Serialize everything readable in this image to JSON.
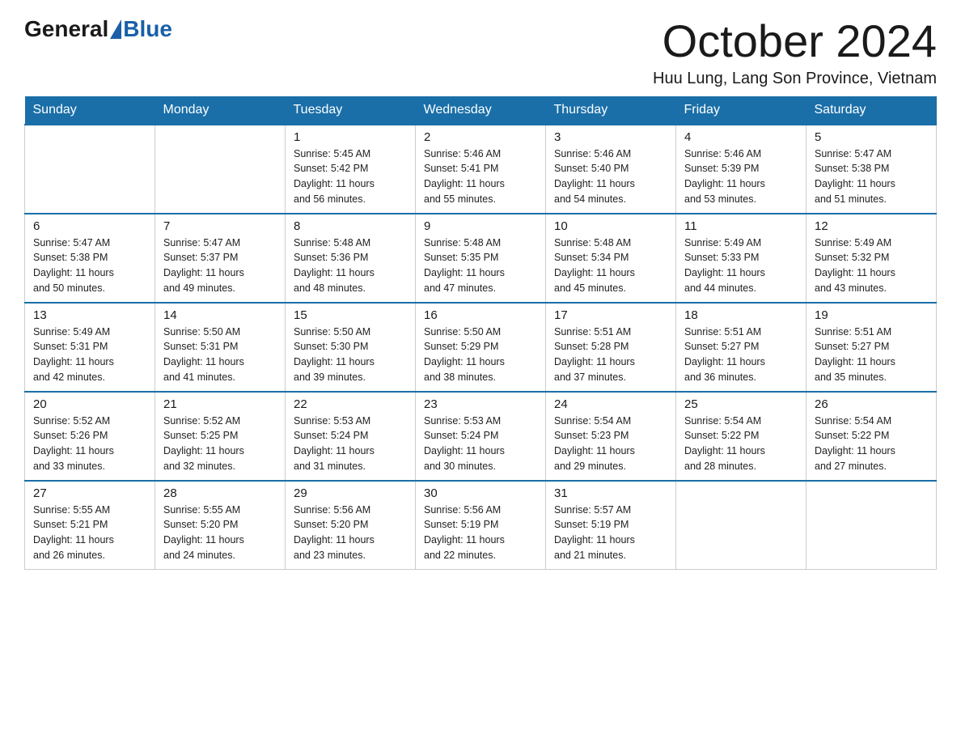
{
  "logo": {
    "general": "General",
    "blue": "Blue"
  },
  "title": {
    "month": "October 2024",
    "location": "Huu Lung, Lang Son Province, Vietnam"
  },
  "days_of_week": [
    "Sunday",
    "Monday",
    "Tuesday",
    "Wednesday",
    "Thursday",
    "Friday",
    "Saturday"
  ],
  "weeks": [
    [
      {
        "day": "",
        "info": ""
      },
      {
        "day": "",
        "info": ""
      },
      {
        "day": "1",
        "info": "Sunrise: 5:45 AM\nSunset: 5:42 PM\nDaylight: 11 hours\nand 56 minutes."
      },
      {
        "day": "2",
        "info": "Sunrise: 5:46 AM\nSunset: 5:41 PM\nDaylight: 11 hours\nand 55 minutes."
      },
      {
        "day": "3",
        "info": "Sunrise: 5:46 AM\nSunset: 5:40 PM\nDaylight: 11 hours\nand 54 minutes."
      },
      {
        "day": "4",
        "info": "Sunrise: 5:46 AM\nSunset: 5:39 PM\nDaylight: 11 hours\nand 53 minutes."
      },
      {
        "day": "5",
        "info": "Sunrise: 5:47 AM\nSunset: 5:38 PM\nDaylight: 11 hours\nand 51 minutes."
      }
    ],
    [
      {
        "day": "6",
        "info": "Sunrise: 5:47 AM\nSunset: 5:38 PM\nDaylight: 11 hours\nand 50 minutes."
      },
      {
        "day": "7",
        "info": "Sunrise: 5:47 AM\nSunset: 5:37 PM\nDaylight: 11 hours\nand 49 minutes."
      },
      {
        "day": "8",
        "info": "Sunrise: 5:48 AM\nSunset: 5:36 PM\nDaylight: 11 hours\nand 48 minutes."
      },
      {
        "day": "9",
        "info": "Sunrise: 5:48 AM\nSunset: 5:35 PM\nDaylight: 11 hours\nand 47 minutes."
      },
      {
        "day": "10",
        "info": "Sunrise: 5:48 AM\nSunset: 5:34 PM\nDaylight: 11 hours\nand 45 minutes."
      },
      {
        "day": "11",
        "info": "Sunrise: 5:49 AM\nSunset: 5:33 PM\nDaylight: 11 hours\nand 44 minutes."
      },
      {
        "day": "12",
        "info": "Sunrise: 5:49 AM\nSunset: 5:32 PM\nDaylight: 11 hours\nand 43 minutes."
      }
    ],
    [
      {
        "day": "13",
        "info": "Sunrise: 5:49 AM\nSunset: 5:31 PM\nDaylight: 11 hours\nand 42 minutes."
      },
      {
        "day": "14",
        "info": "Sunrise: 5:50 AM\nSunset: 5:31 PM\nDaylight: 11 hours\nand 41 minutes."
      },
      {
        "day": "15",
        "info": "Sunrise: 5:50 AM\nSunset: 5:30 PM\nDaylight: 11 hours\nand 39 minutes."
      },
      {
        "day": "16",
        "info": "Sunrise: 5:50 AM\nSunset: 5:29 PM\nDaylight: 11 hours\nand 38 minutes."
      },
      {
        "day": "17",
        "info": "Sunrise: 5:51 AM\nSunset: 5:28 PM\nDaylight: 11 hours\nand 37 minutes."
      },
      {
        "day": "18",
        "info": "Sunrise: 5:51 AM\nSunset: 5:27 PM\nDaylight: 11 hours\nand 36 minutes."
      },
      {
        "day": "19",
        "info": "Sunrise: 5:51 AM\nSunset: 5:27 PM\nDaylight: 11 hours\nand 35 minutes."
      }
    ],
    [
      {
        "day": "20",
        "info": "Sunrise: 5:52 AM\nSunset: 5:26 PM\nDaylight: 11 hours\nand 33 minutes."
      },
      {
        "day": "21",
        "info": "Sunrise: 5:52 AM\nSunset: 5:25 PM\nDaylight: 11 hours\nand 32 minutes."
      },
      {
        "day": "22",
        "info": "Sunrise: 5:53 AM\nSunset: 5:24 PM\nDaylight: 11 hours\nand 31 minutes."
      },
      {
        "day": "23",
        "info": "Sunrise: 5:53 AM\nSunset: 5:24 PM\nDaylight: 11 hours\nand 30 minutes."
      },
      {
        "day": "24",
        "info": "Sunrise: 5:54 AM\nSunset: 5:23 PM\nDaylight: 11 hours\nand 29 minutes."
      },
      {
        "day": "25",
        "info": "Sunrise: 5:54 AM\nSunset: 5:22 PM\nDaylight: 11 hours\nand 28 minutes."
      },
      {
        "day": "26",
        "info": "Sunrise: 5:54 AM\nSunset: 5:22 PM\nDaylight: 11 hours\nand 27 minutes."
      }
    ],
    [
      {
        "day": "27",
        "info": "Sunrise: 5:55 AM\nSunset: 5:21 PM\nDaylight: 11 hours\nand 26 minutes."
      },
      {
        "day": "28",
        "info": "Sunrise: 5:55 AM\nSunset: 5:20 PM\nDaylight: 11 hours\nand 24 minutes."
      },
      {
        "day": "29",
        "info": "Sunrise: 5:56 AM\nSunset: 5:20 PM\nDaylight: 11 hours\nand 23 minutes."
      },
      {
        "day": "30",
        "info": "Sunrise: 5:56 AM\nSunset: 5:19 PM\nDaylight: 11 hours\nand 22 minutes."
      },
      {
        "day": "31",
        "info": "Sunrise: 5:57 AM\nSunset: 5:19 PM\nDaylight: 11 hours\nand 21 minutes."
      },
      {
        "day": "",
        "info": ""
      },
      {
        "day": "",
        "info": ""
      }
    ]
  ]
}
